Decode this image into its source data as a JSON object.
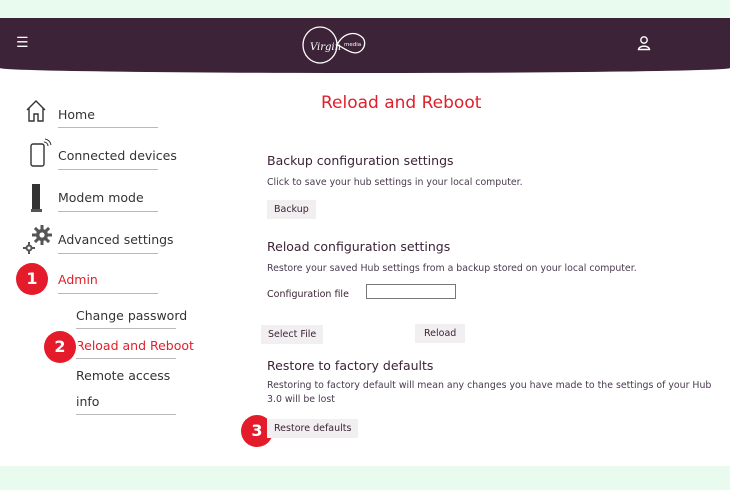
{
  "header": {
    "menu_icon": "hamburger-menu-icon",
    "logo_alt": "Virgin media",
    "logo_word1": "Virgin",
    "logo_word2": "media",
    "user_icon": "user-icon",
    "colors": {
      "header_bg": "#3c2337",
      "accent": "#e0202a"
    }
  },
  "sidebar": {
    "items": [
      {
        "label": "Home",
        "icon": "home-icon"
      },
      {
        "label": "Connected devices",
        "icon": "connected-devices-icon"
      },
      {
        "label": "Modem mode",
        "icon": "modem-icon"
      },
      {
        "label": "Advanced settings",
        "icon": "gear-icon"
      },
      {
        "label": "Admin",
        "icon": "admin-icon"
      }
    ],
    "sub_items": [
      {
        "label": "Change password"
      },
      {
        "label": "Reload and Reboot"
      },
      {
        "label": "Remote access"
      },
      {
        "label": "info"
      }
    ]
  },
  "badges": [
    "1",
    "2",
    "3"
  ],
  "main": {
    "title": "Reload and Reboot",
    "backup": {
      "title": "Backup configuration settings",
      "description": "Click to save your hub settings in your local computer.",
      "button": "Backup"
    },
    "reload": {
      "title": "Reload configuration settings",
      "description": "Restore your saved Hub settings from a backup stored on your local computer.",
      "field_label": "Configuration file",
      "field_value": "",
      "select_button": "Select File",
      "reload_button": "Reload"
    },
    "factory": {
      "title": "Restore to factory defaults",
      "description": "Restoring to factory default will mean any changes you have made to the settings of your Hub 3.0 will be lost",
      "button": "Restore defaults"
    }
  }
}
